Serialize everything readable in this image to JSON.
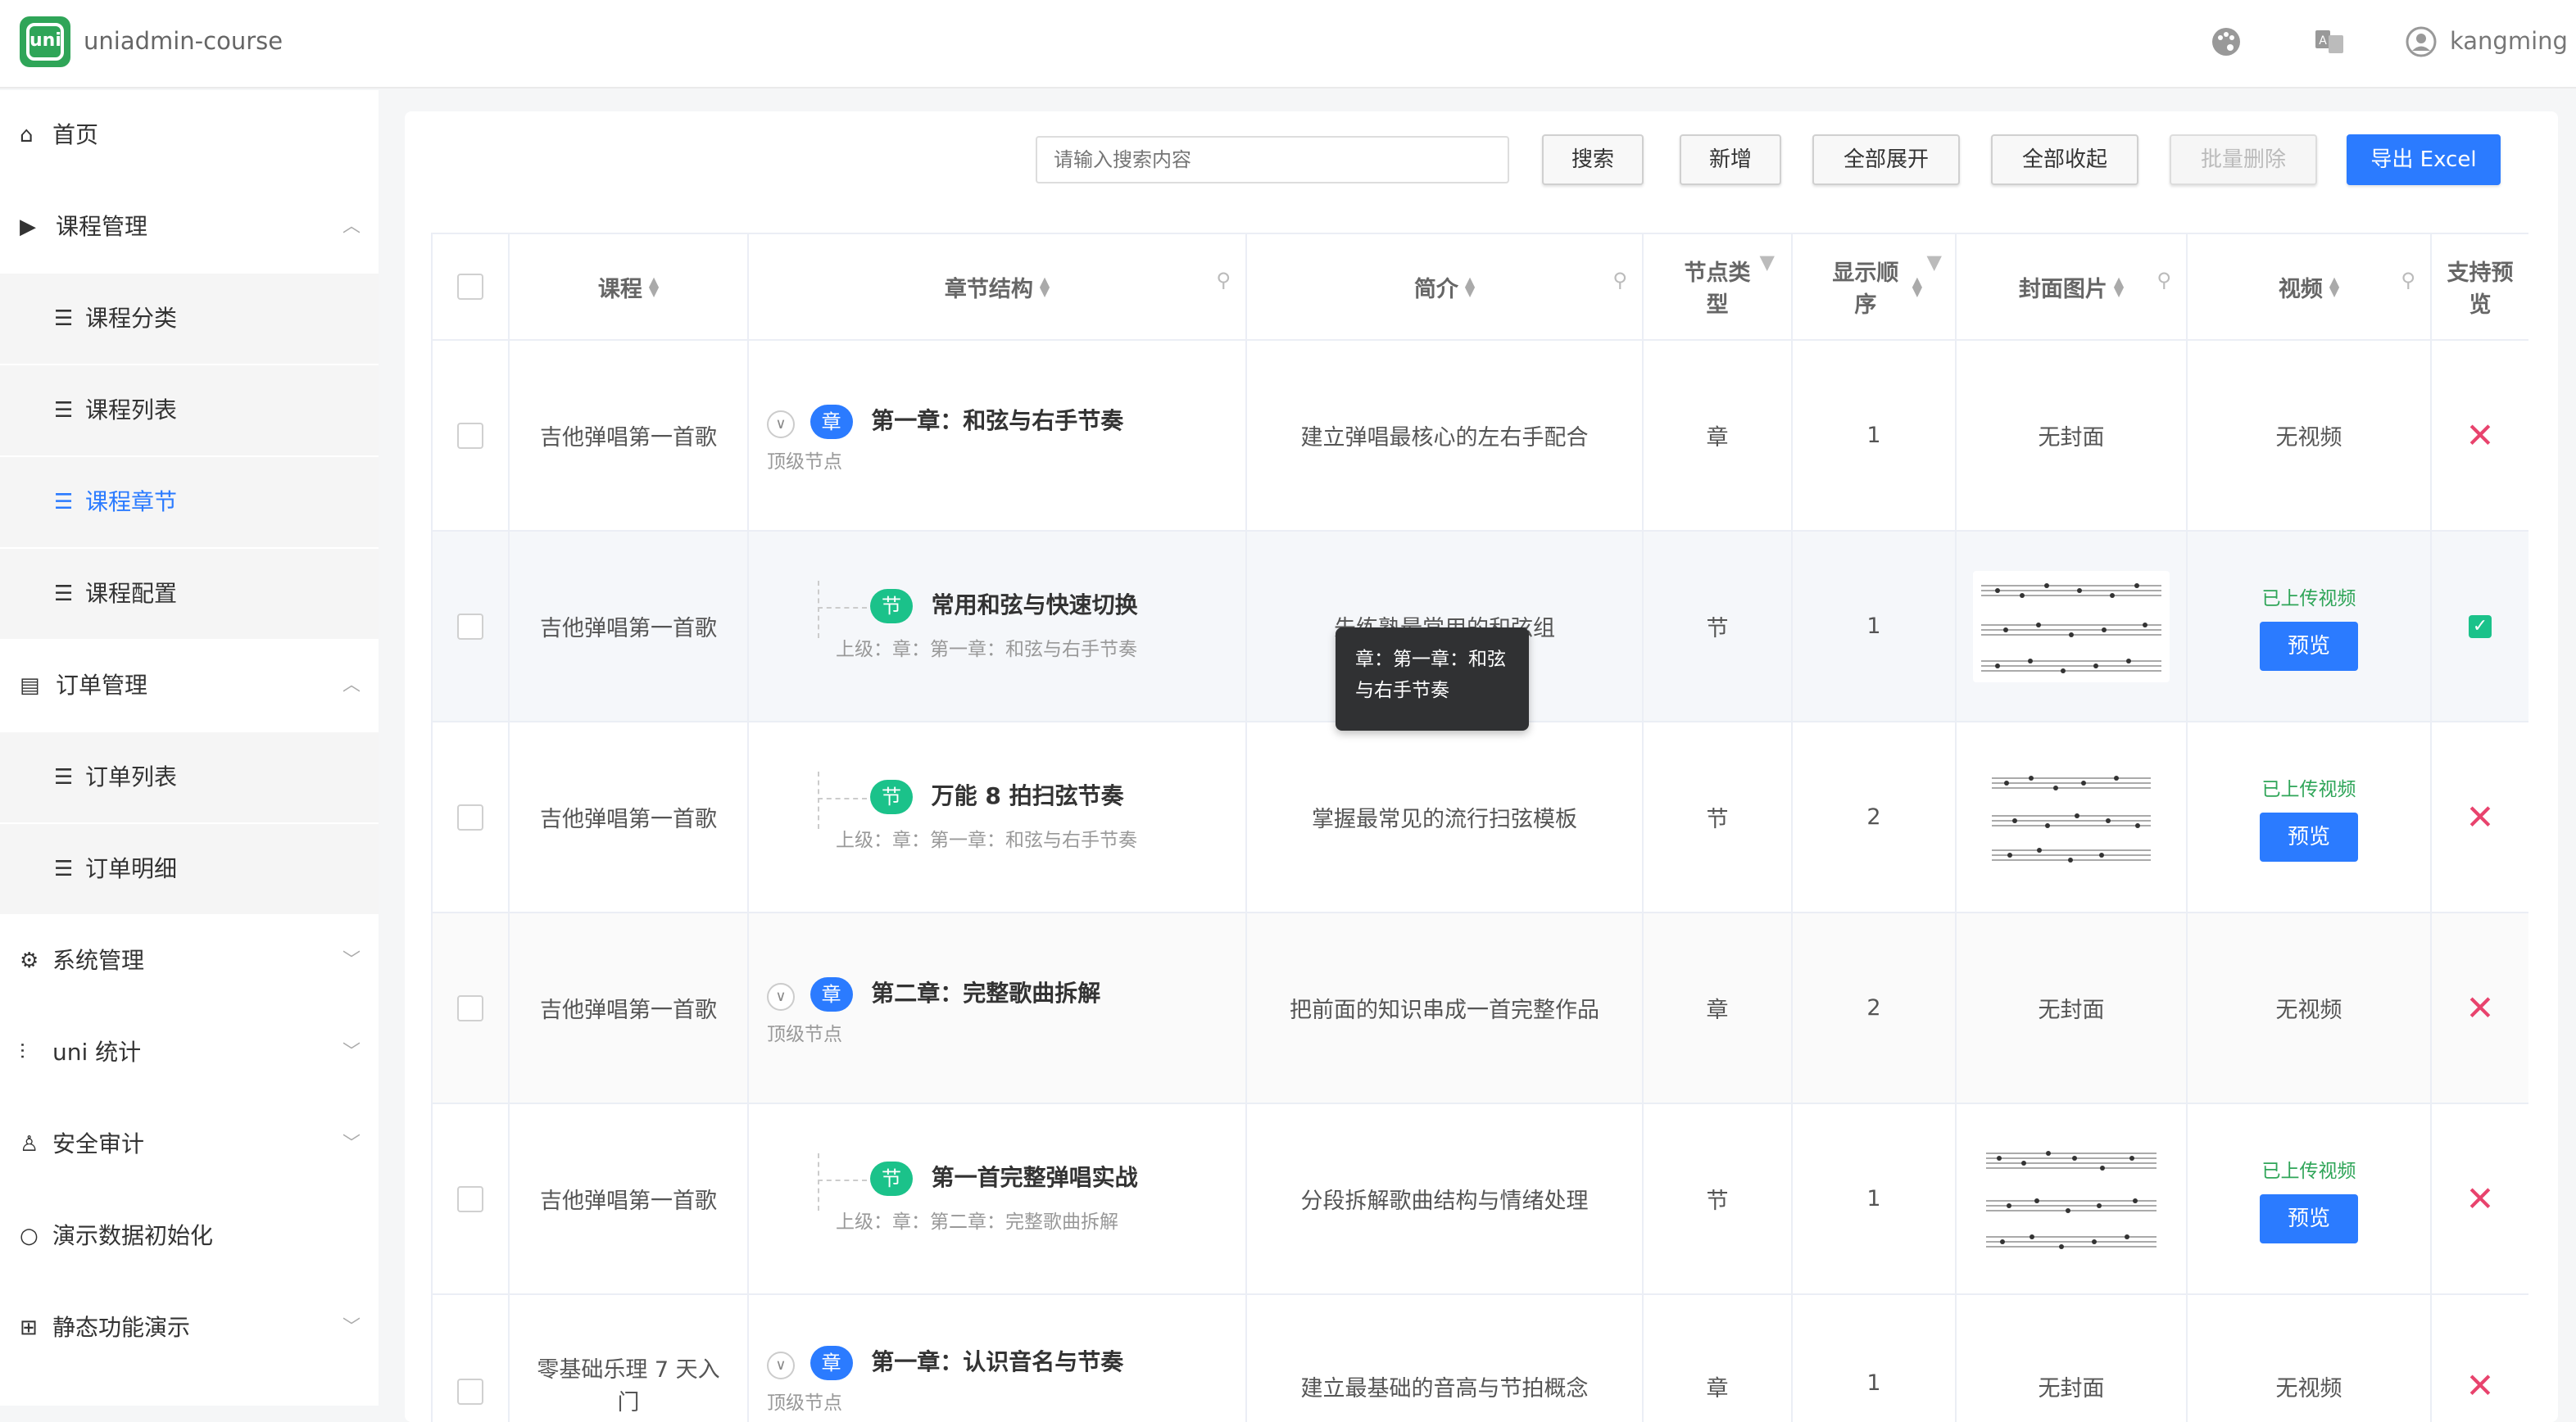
{
  "app": {
    "title": "uniadmin-course",
    "logo_text": "uni"
  },
  "topbar": {
    "theme_icon": "palette-icon",
    "lang_icon": "translate-icon",
    "user_icon": "user-icon",
    "user_name": "kangming"
  },
  "sidebar": {
    "items": [
      {
        "label": "首页",
        "icon": "home-icon"
      },
      {
        "label": "课程管理",
        "icon": "video-icon",
        "expanded": true
      },
      {
        "label": "课程分类",
        "icon": "list-icon"
      },
      {
        "label": "课程列表",
        "icon": "list-icon"
      },
      {
        "label": "课程章节",
        "icon": "list-icon",
        "active": true
      },
      {
        "label": "课程配置",
        "icon": "list-icon"
      },
      {
        "label": "订单管理",
        "icon": "order-icon",
        "expanded": true
      },
      {
        "label": "订单列表",
        "icon": "list-icon"
      },
      {
        "label": "订单明细",
        "icon": "list-icon"
      },
      {
        "label": "系统管理",
        "icon": "gear-icon"
      },
      {
        "label": "uni 统计",
        "icon": "chart-icon"
      },
      {
        "label": "安全审计",
        "icon": "person-icon"
      },
      {
        "label": "演示数据初始化",
        "icon": "refresh-icon"
      },
      {
        "label": "静态功能演示",
        "icon": "grid-icon"
      }
    ]
  },
  "toolbar": {
    "search_placeholder": "请输入搜索内容",
    "search_label": "搜索",
    "add_label": "新增",
    "expand_all_label": "全部展开",
    "collapse_all_label": "全部收起",
    "batch_delete_label": "批量删除",
    "export_label": "导出 Excel"
  },
  "table": {
    "headers": {
      "course": "课程",
      "chapter": "章节结构",
      "intro": "简介",
      "node_type": "节点类型",
      "order": "显示顺序",
      "cover": "封面图片",
      "video": "视频",
      "preview": "支持预览"
    },
    "rows": [
      {
        "course": "吉他弹唱第一首歌",
        "tag": "章",
        "title": "第一章：和弦与右手节奏",
        "sub": "顶级节点",
        "intro": "建立弹唱最核心的左右手配合",
        "type": "章",
        "order": "1",
        "cover": "无封面",
        "video": "无视频",
        "preview": false
      },
      {
        "course": "吉他弹唱第一首歌",
        "tag": "节",
        "title": "常用和弦与快速切换",
        "sub": "上级：章：第一章：和弦与右手节奏",
        "intro": "先练熟最常用的和弦组",
        "type": "节",
        "order": "1",
        "cover_image": "sheet-music",
        "video": "已上传视频",
        "preview_btn": "预览",
        "preview": true
      },
      {
        "course": "吉他弹唱第一首歌",
        "tag": "节",
        "title": "万能 8 拍扫弦节奏",
        "sub": "上级：章：第一章：和弦与右手节奏",
        "intro": "掌握最常见的流行扫弦模板",
        "type": "节",
        "order": "2",
        "cover_image": "sheet-music",
        "video": "已上传视频",
        "preview_btn": "预览",
        "preview": false
      },
      {
        "course": "吉他弹唱第一首歌",
        "tag": "章",
        "title": "第二章：完整歌曲拆解",
        "sub": "顶级节点",
        "intro": "把前面的知识串成一首完整作品",
        "type": "章",
        "order": "2",
        "cover": "无封面",
        "video": "无视频",
        "preview": false
      },
      {
        "course": "吉他弹唱第一首歌",
        "tag": "节",
        "title": "第一首完整弹唱实战",
        "sub": "上级：章：第二章：完整歌曲拆解",
        "intro": "分段拆解歌曲结构与情绪处理",
        "type": "节",
        "order": "1",
        "cover_image": "sheet-music",
        "video": "已上传视频",
        "preview_btn": "预览",
        "preview": false
      },
      {
        "course": "零基础乐理 7 天入门",
        "tag": "章",
        "title": "第一章：认识音名与节奏",
        "sub": "顶级节点",
        "intro": "建立最基础的音高与节拍概念",
        "type": "章",
        "order": "1",
        "cover": "无封面",
        "video": "无视频",
        "preview": false
      }
    ]
  },
  "tooltip": {
    "text": "章：第一章：和弦与右手节奏"
  },
  "colors": {
    "primary": "#2b7bff",
    "success": "#1bc28a",
    "danger": "#e8436d",
    "brand": "#2fa558"
  }
}
